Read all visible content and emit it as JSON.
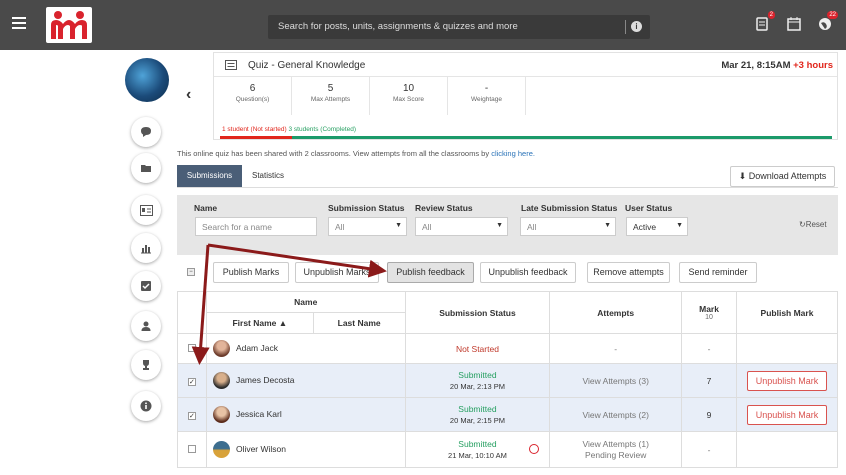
{
  "topbar": {
    "search_placeholder": "Search for posts, units, assignments & quizzes and more",
    "notif_badge": "2",
    "alerts_badge": "22"
  },
  "quiz": {
    "title": "Quiz - General Knowledge",
    "date": "Mar 21, 8:15AM",
    "extra": "+3 hours",
    "stats": [
      {
        "value": "6",
        "label": "Question(s)"
      },
      {
        "value": "5",
        "label": "Max Attempts"
      },
      {
        "value": "10",
        "label": "Max Score"
      },
      {
        "value": "-",
        "label": "Weightage"
      }
    ],
    "not_started": "1 student (Not started)",
    "completed": "3 students (Completed)"
  },
  "shared_text": "This online quiz has been shared with 2 classrooms. View attempts from all the classrooms by",
  "shared_link": "clicking here.",
  "tabs": {
    "submissions": "Submissions",
    "statistics": "Statistics"
  },
  "download_label": "Download Attempts",
  "filters": {
    "name_label": "Name",
    "name_placeholder": "Search for a name",
    "submission_label": "Submission Status",
    "submission_value": "All",
    "review_label": "Review Status",
    "review_value": "All",
    "late_label": "Late Submission Status",
    "late_value": "All",
    "user_label": "User Status",
    "user_value": "Active",
    "reset_label": "Reset"
  },
  "actions": [
    "Publish Marks",
    "Unpublish Marks",
    "Publish feedback",
    "Unpublish feedback",
    "Remove attempts",
    "Send reminder"
  ],
  "table": {
    "name_header": "Name",
    "first_name": "First Name",
    "last_name": "Last Name",
    "submission_status": "Submission Status",
    "attempts": "Attempts",
    "mark": "Mark",
    "mark_max": "10",
    "publish_mark": "Publish Mark",
    "rows": [
      {
        "name": "Adam Jack",
        "status": "Not Started",
        "date": "",
        "attempts": "-",
        "attempts2": "",
        "mark": "-",
        "publish": "",
        "checked": false
      },
      {
        "name": "James Decosta",
        "status": "Submitted",
        "date": "20 Mar, 2:13 PM",
        "attempts": "View Attempts (3)",
        "attempts2": "",
        "mark": "7",
        "publish": "Unpublish Mark",
        "checked": true
      },
      {
        "name": "Jessica Karl",
        "status": "Submitted",
        "date": "20 Mar, 2:15 PM",
        "attempts": "View Attempts (2)",
        "attempts2": "",
        "mark": "9",
        "publish": "Unpublish Mark",
        "checked": true
      },
      {
        "name": "Oliver Wilson",
        "status": "Submitted",
        "date": "21 Mar, 10:10 AM",
        "attempts": "View Attempts (1)",
        "attempts2": "Pending Review",
        "mark": "-",
        "publish": "",
        "checked": false
      }
    ]
  },
  "colors": {
    "topbar": "#4a4a4a",
    "accent_tab": "#4a5e77",
    "red": "#e1251b",
    "green": "#27a062",
    "arrow": "#8b1a1a"
  }
}
